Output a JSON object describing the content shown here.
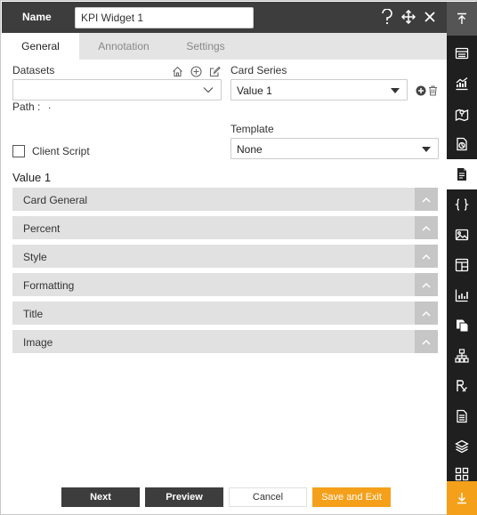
{
  "header": {
    "label": "Name",
    "name_value": "KPI Widget 1",
    "icons": [
      "help-icon",
      "move-icon",
      "close-icon"
    ]
  },
  "tabs": [
    {
      "label": "General",
      "active": true
    },
    {
      "label": "Annotation",
      "active": false
    },
    {
      "label": "Settings",
      "active": false
    }
  ],
  "form": {
    "datasets_label": "Datasets",
    "datasets_value": "",
    "path_label": "Path :",
    "path_value": ".",
    "card_series_label": "Card Series",
    "card_series_value": "Value 1",
    "template_label": "Template",
    "template_value": "None",
    "client_script_label": "Client Script",
    "client_script_checked": false
  },
  "section_title": "Value 1",
  "accordions": [
    {
      "label": "Card General"
    },
    {
      "label": "Percent"
    },
    {
      "label": "Style"
    },
    {
      "label": "Formatting"
    },
    {
      "label": "Title"
    },
    {
      "label": "Image"
    }
  ],
  "footer": {
    "next": "Next",
    "preview": "Preview",
    "cancel": "Cancel",
    "save_exit": "Save and Exit"
  },
  "sidebar": {
    "items": [
      "table-icon",
      "chart-icon",
      "map-icon",
      "document-chart-icon",
      "document-icon",
      "code-braces-icon",
      "image-icon",
      "widget-icon",
      "bar-chart-icon",
      "copy-icon",
      "hierarchy-icon",
      "rx-icon",
      "report-icon",
      "layers-icon",
      "grid-icon"
    ],
    "active_index": 4
  },
  "colors": {
    "header_bg": "#3d3d3d",
    "accent": "#f5a01a",
    "sidebar_bg": "#1f1f1f"
  }
}
